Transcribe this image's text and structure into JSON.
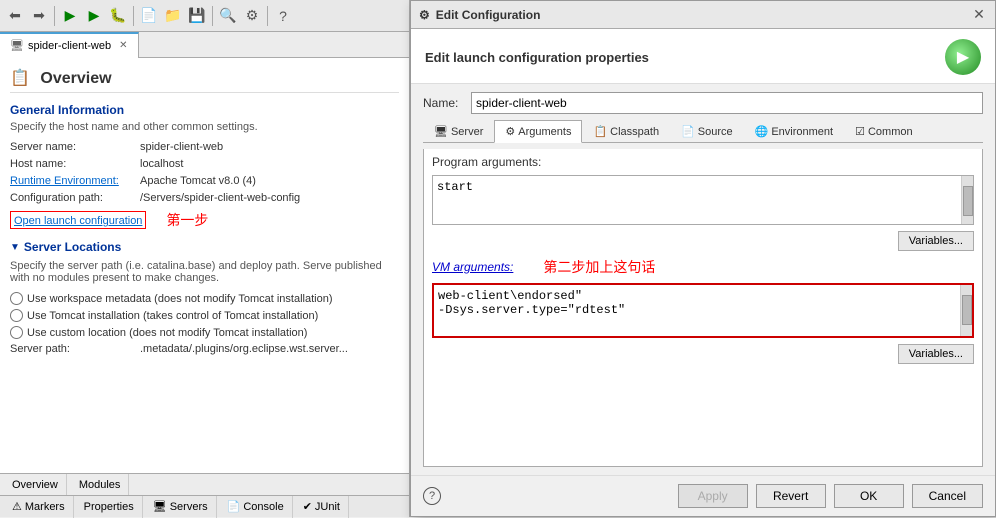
{
  "toolbar": {
    "buttons": [
      "⬅",
      "➡",
      "⬆",
      "▶",
      "◼",
      "⏸",
      "🔧",
      "🔍",
      "⚙",
      "📋",
      "📁",
      "💾",
      "🖨",
      "🔎",
      "❓"
    ]
  },
  "left_panel": {
    "tab_label": "spider-client-web",
    "overview_title": "Overview",
    "general_section_title": "General Information",
    "general_section_desc": "Specify the host name and other common settings.",
    "fields": [
      {
        "label": "Server name:",
        "value": "spider-client-web"
      },
      {
        "label": "Host name:",
        "value": "localhost"
      },
      {
        "label": "Runtime Environment:",
        "value": "Apache Tomcat v8.0 (4)",
        "is_link": true
      },
      {
        "label": "Configuration path:",
        "value": "/Servers/spider-client-web-config"
      }
    ],
    "open_launch_label": "Open launch configuration",
    "annotation_step1": "第一步",
    "server_locations_title": "Server Locations",
    "server_locations_desc": "Specify the server path (i.e. catalina.base) and deploy path. Serve published with no modules present to make changes.",
    "radio_options": [
      "Use workspace metadata (does not modify Tomcat installation)",
      "Use Tomcat installation (takes control of Tomcat installation)",
      "Use custom location (does not modify Tomcat installation)"
    ],
    "server_path_label": "Server path:",
    "server_path_value": ".metadata/.plugins/org.eclipse.wst.server..."
  },
  "bottom_tabs": [
    {
      "label": "Overview"
    },
    {
      "label": "Modules"
    }
  ],
  "markers_bar": {
    "tabs": [
      "Markers",
      "Properties",
      "Servers",
      "Console",
      "JUnit"
    ]
  },
  "dialog": {
    "title": "Edit Configuration",
    "header_title": "Edit launch configuration properties",
    "name_label": "Name:",
    "name_value": "spider-client-web",
    "tabs": [
      {
        "label": "Server",
        "icon": "🖥"
      },
      {
        "label": "Arguments",
        "icon": "⚙",
        "active": true
      },
      {
        "label": "Classpath",
        "icon": "📋"
      },
      {
        "label": "Source",
        "icon": "📄"
      },
      {
        "label": "Environment",
        "icon": "🌐"
      },
      {
        "label": "Common",
        "icon": "⚡"
      }
    ],
    "program_args_label": "Program arguments:",
    "program_args_value": "start",
    "variables_btn_label": "Variables...",
    "vm_args_label": "VM arguments:",
    "vm_args_value": "web-client\\endorsed\"\n-Dsys.server.type=\"rdtest\"",
    "annotation_step2": "第二步加上这句话",
    "variables_btn2_label": "Variables...",
    "footer": {
      "apply_label": "Apply",
      "revert_label": "Revert",
      "ok_label": "OK",
      "cancel_label": "Cancel"
    }
  }
}
